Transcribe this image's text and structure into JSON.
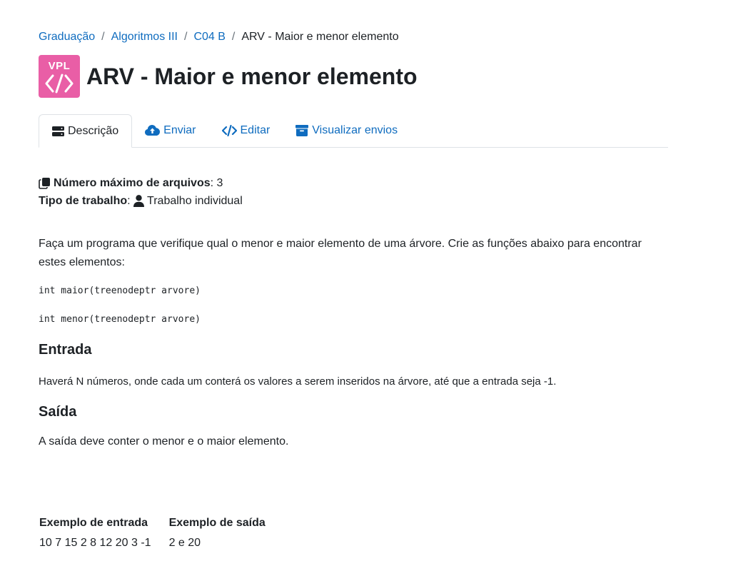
{
  "breadcrumb": {
    "items": [
      "Graduação",
      "Algoritmos III",
      "C04 B"
    ],
    "current": "ARV - Maior e menor elemento",
    "separator": "/"
  },
  "header": {
    "icon_text": "VPL",
    "icon_color": "#e95ea6",
    "title": "ARV - Maior e menor elemento"
  },
  "tabs": [
    {
      "label": "Descrição",
      "icon": "server-icon",
      "active": true
    },
    {
      "label": "Enviar",
      "icon": "cloud-upload-icon",
      "active": false
    },
    {
      "label": "Editar",
      "icon": "code-icon",
      "active": false
    },
    {
      "label": "Visualizar envios",
      "icon": "archive-icon",
      "active": false
    }
  ],
  "meta": {
    "max_files_label": "Número máximo de arquivos",
    "max_files_value": "3",
    "work_type_label": "Tipo de trabalho",
    "work_type_value": "Trabalho individual"
  },
  "description": {
    "intro": "Faça um programa que verifique qual o menor e maior elemento de uma árvore. Crie as funções abaixo para encontrar estes elementos:",
    "code_1": "int maior(treenodeptr arvore)",
    "code_2": "int menor(treenodeptr arvore)",
    "input_heading": "Entrada",
    "input_text": "Haverá N números, onde cada um conterá os valores a serem inseridos na árvore, até que a entrada seja -1.",
    "output_heading": "Saída",
    "output_text": "A saída deve conter o menor e o maior elemento."
  },
  "examples": {
    "headers": [
      "Exemplo de entrada",
      "Exemplo de saída"
    ],
    "rows": [
      [
        "10 7 15 2 8 12 20 3 -1",
        "2 e 20"
      ]
    ]
  },
  "colors": {
    "link": "#0f6cbf",
    "text": "#1d2125",
    "border": "#dee2e6"
  }
}
